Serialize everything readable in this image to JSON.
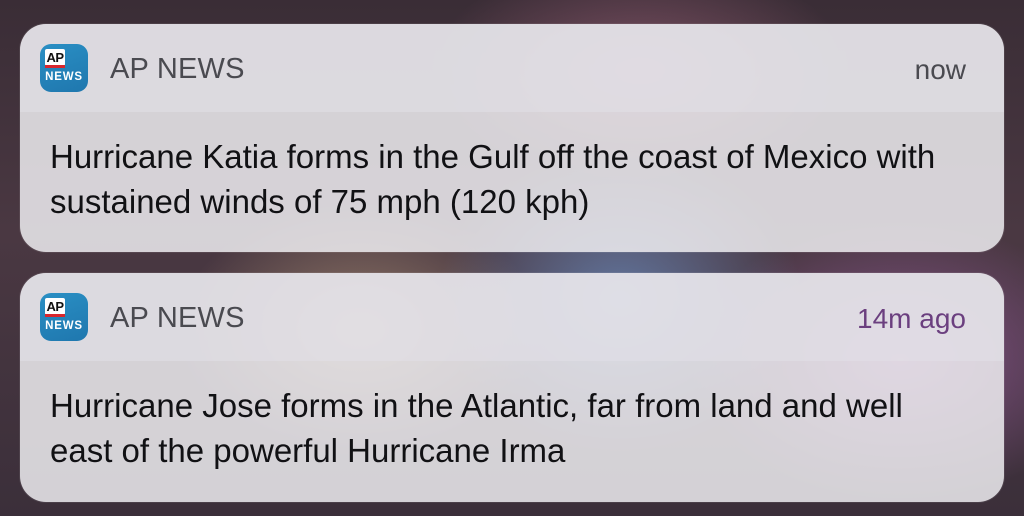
{
  "notifications": [
    {
      "app_icon": {
        "ap": "AP",
        "news": "NEWS"
      },
      "app_name": "AP NEWS",
      "time": "now",
      "body": "Hurricane Katia forms in the Gulf off the coast of Mexico with sustained winds of 75 mph (120 kph)"
    },
    {
      "app_icon": {
        "ap": "AP",
        "news": "NEWS"
      },
      "app_name": "AP NEWS",
      "time": "14m ago",
      "body": "Hurricane Jose forms in the Atlantic, far from land and well east of the powerful Hurricane Irma"
    }
  ],
  "colors": {
    "icon_blue": "#1f77ae",
    "icon_red": "#d8262d",
    "timestamp_purple": "#6b3f7f"
  }
}
